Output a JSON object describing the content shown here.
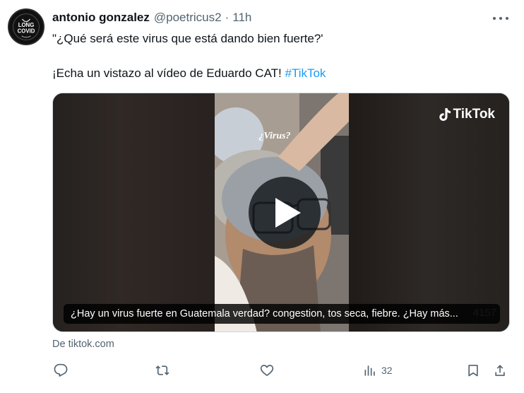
{
  "tweet": {
    "author_name": "antonio gonzalez",
    "handle": "@poetricus2",
    "separator": "·",
    "time": "11h",
    "avatar_text": {
      "top": "LONG",
      "bottom": "COVID"
    },
    "text_line1": "\"¿Qué será este virus que está dando bien fuerte?'",
    "text_line2_prefix": "¡Echa un vistazo al vídeo de Eduardo CAT! ",
    "hashtag": "#TikTok",
    "more_icon": "ellipsis-icon"
  },
  "media": {
    "brand_label": "TikTok",
    "overlay_text": "¿Virus?",
    "caption": "¿Hay un virus fuerte en Guatemala verdad? congestion, tos seca, fiebre. ¿Hay más...",
    "ghost_number": "4157",
    "play_icon": "play-icon",
    "source": "De tiktok.com"
  },
  "actions": {
    "reply_icon": "reply-icon",
    "retweet_icon": "retweet-icon",
    "like_icon": "heart-icon",
    "views_icon": "views-icon",
    "views_count": "32",
    "bookmark_icon": "bookmark-icon",
    "share_icon": "share-icon"
  },
  "colors": {
    "text": "#0f1419",
    "secondary": "#536471",
    "link": "#1d9bf0"
  }
}
